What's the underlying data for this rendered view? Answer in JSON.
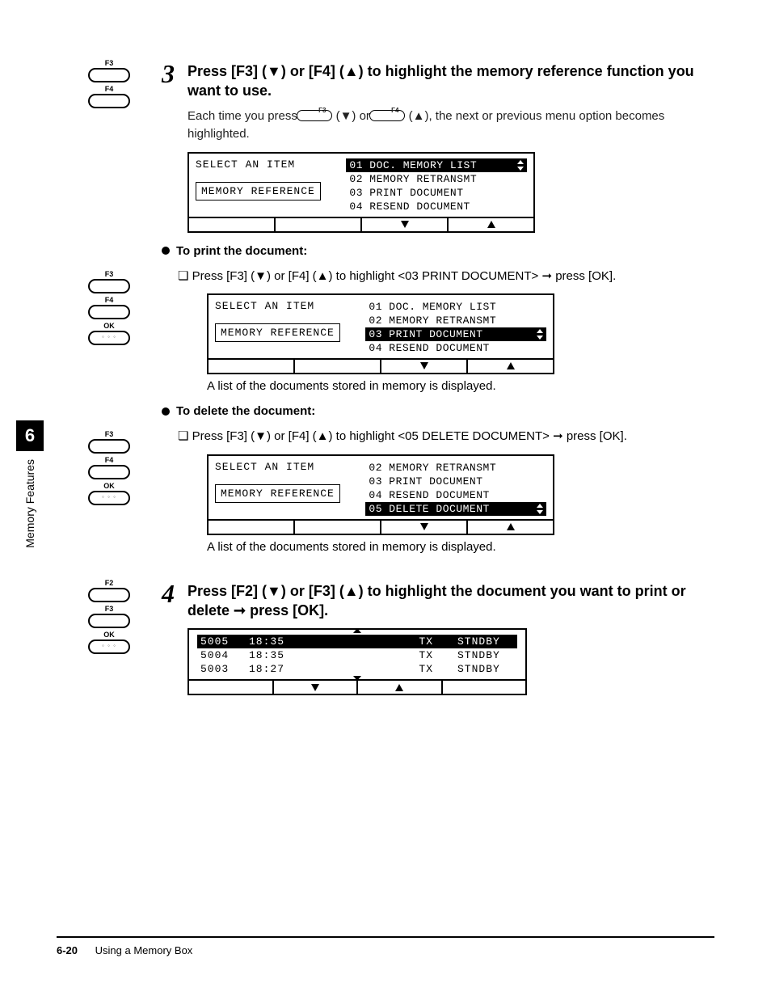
{
  "keys": {
    "f2": "F2",
    "f3": "F3",
    "f4": "F4",
    "ok": "OK"
  },
  "step3": {
    "heading": "Press [F3] (▼) or [F4] (▲) to highlight the memory reference function you want to use.",
    "body_a": "Each time you press ",
    "body_b": " (▼) or ",
    "body_c": " (▲), the next or previous menu option becomes highlighted.",
    "lcd": {
      "title": "SELECT AN ITEM",
      "box": "MEMORY REFERENCE",
      "items": [
        "01 DOC. MEMORY LIST",
        "02 MEMORY RETRANSMT",
        "03 PRINT DOCUMENT",
        "04 RESEND DOCUMENT"
      ],
      "selected_index": 0
    }
  },
  "print_section": {
    "heading": "To print the document:",
    "instr": "Press [F3] (▼) or [F4] (▲) to highlight <03 PRINT DOCUMENT> ➞ press [OK].",
    "lcd": {
      "title": "SELECT AN ITEM",
      "box": "MEMORY REFERENCE",
      "items": [
        "01 DOC. MEMORY LIST",
        "02 MEMORY RETRANSMT",
        "03 PRINT DOCUMENT",
        "04 RESEND DOCUMENT"
      ],
      "selected_index": 2
    },
    "caption": "A list of the documents stored in memory is displayed."
  },
  "delete_section": {
    "heading": "To delete the document:",
    "instr": "Press [F3] (▼) or [F4] (▲) to highlight <05 DELETE DOCUMENT> ➞ press [OK].",
    "lcd": {
      "title": "SELECT AN ITEM",
      "box": "MEMORY REFERENCE",
      "items": [
        "02 MEMORY RETRANSMT",
        "03 PRINT DOCUMENT",
        "04 RESEND DOCUMENT",
        "05 DELETE DOCUMENT"
      ],
      "selected_index": 3
    },
    "caption": "A list of the documents stored in memory is displayed."
  },
  "step4": {
    "heading": "Press [F2] (▼) or [F3] (▲) to highlight the document you want to print or delete ➞ press [OK].",
    "rows": [
      {
        "id": "5005",
        "time": "18:35",
        "mode": "TX",
        "status": "STNDBY"
      },
      {
        "id": "5004",
        "time": "18:35",
        "mode": "TX",
        "status": "STNDBY"
      },
      {
        "id": "5003",
        "time": "18:27",
        "mode": "TX",
        "status": "STNDBY"
      }
    ],
    "selected_index": 0
  },
  "sidebar": {
    "chapter": "6",
    "label": "Memory Features"
  },
  "footer": {
    "page": "6-20",
    "title": "Using a Memory Box"
  }
}
